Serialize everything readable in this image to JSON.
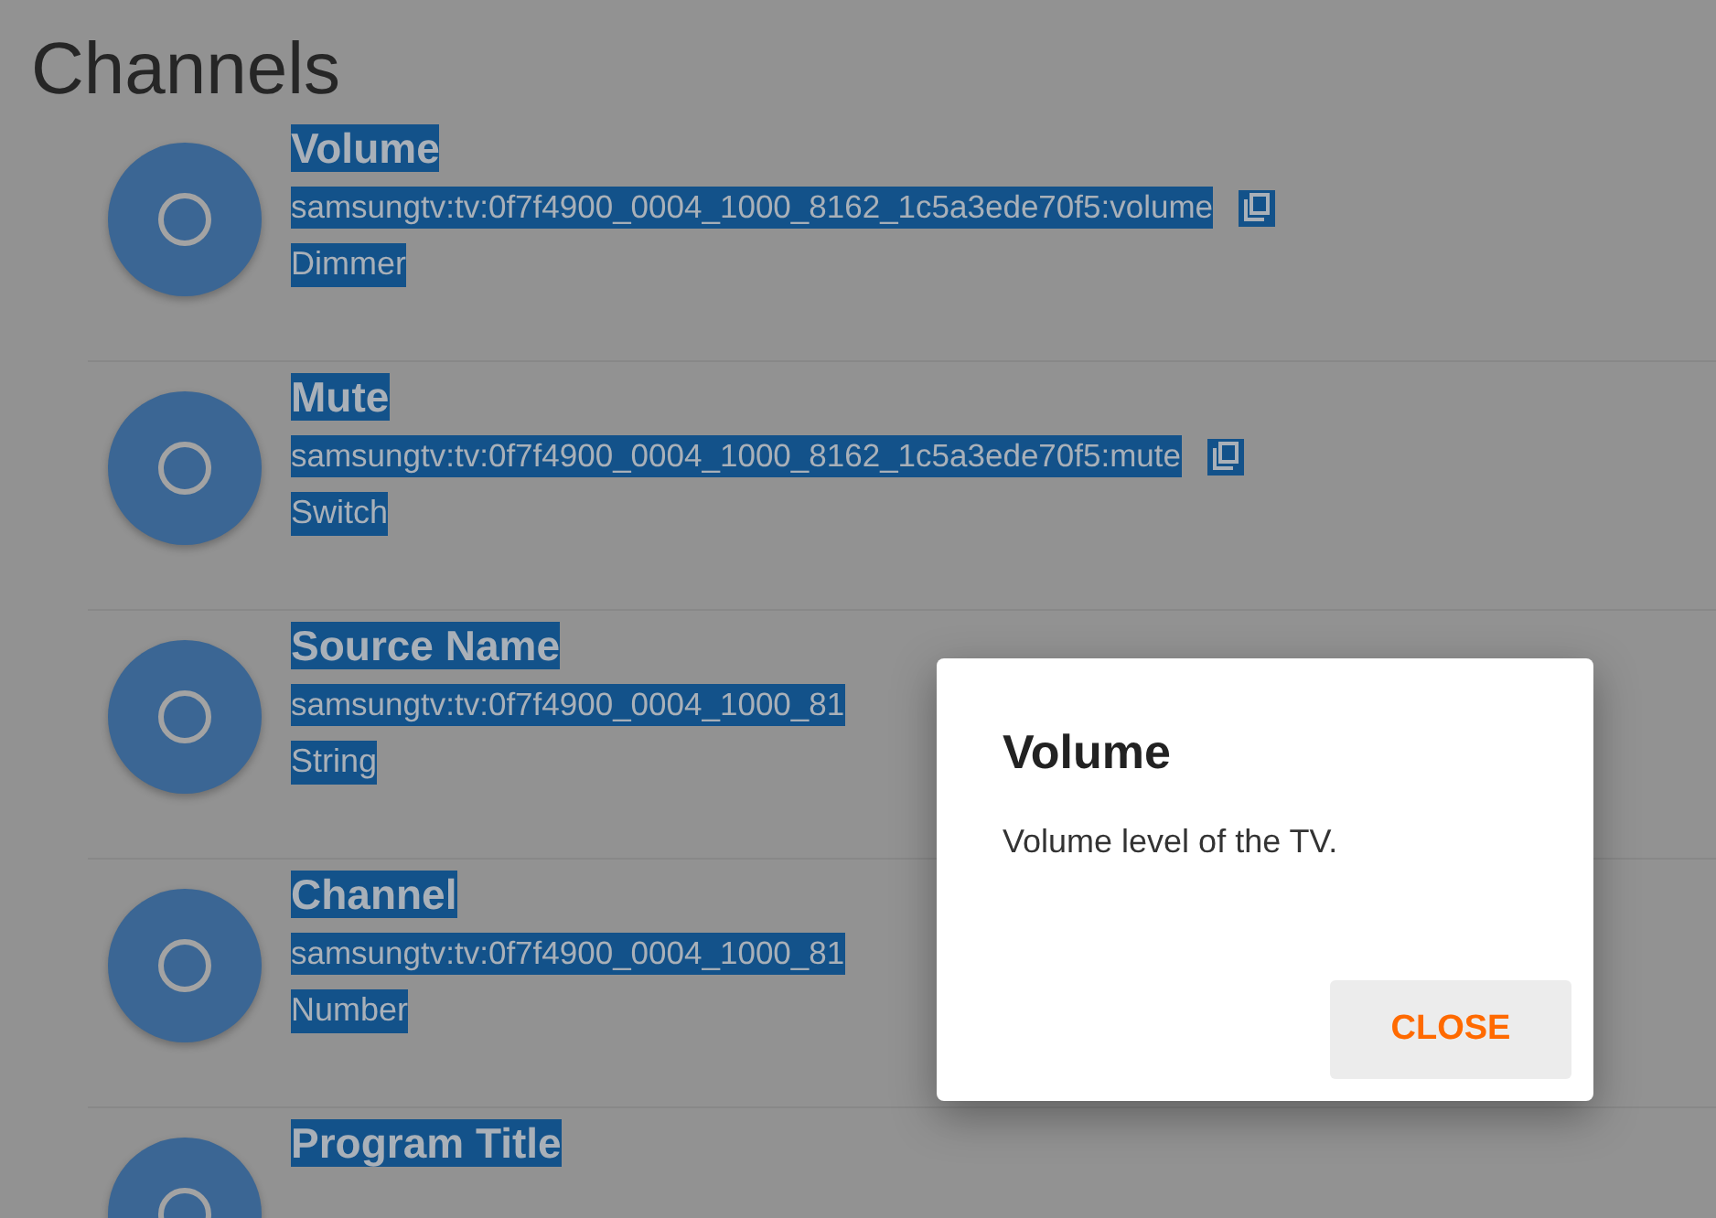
{
  "page_title": "Channels",
  "text_selected": true,
  "channels": [
    {
      "label": "Volume",
      "uid": "samsungtv:tv:0f7f4900_0004_1000_8162_1c5a3ede70f5:volume",
      "type": "Dimmer",
      "copy_icon": true
    },
    {
      "label": "Mute",
      "uid": "samsungtv:tv:0f7f4900_0004_1000_8162_1c5a3ede70f5:mute",
      "type": "Switch",
      "copy_icon": true
    },
    {
      "label": "Source Name",
      "uid": "samsungtv:tv:0f7f4900_0004_1000_81",
      "type": "String"
    },
    {
      "label": "Channel",
      "uid": "samsungtv:tv:0f7f4900_0004_1000_81",
      "type": "Number"
    },
    {
      "label": "Program Title"
    }
  ],
  "dialog": {
    "title": "Volume",
    "text": "Volume level of the TV.",
    "buttons": [
      "CLOSE"
    ]
  }
}
